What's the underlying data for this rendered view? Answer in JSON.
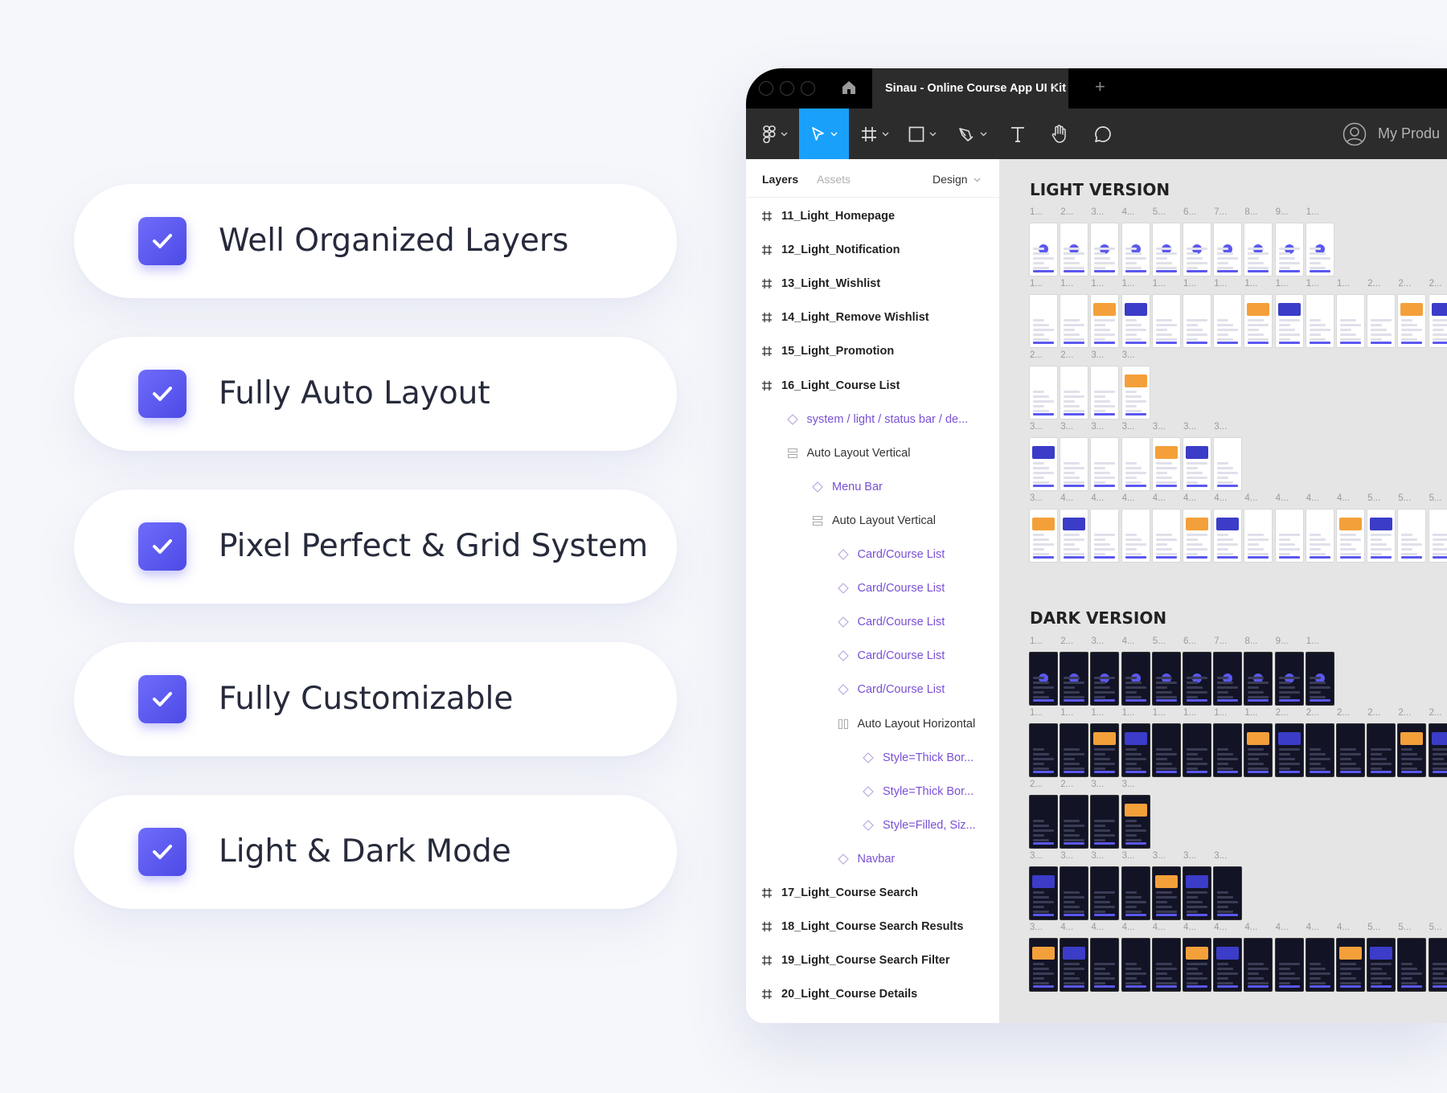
{
  "features": [
    {
      "label": "Well Organized Layers"
    },
    {
      "label": "Fully Auto Layout"
    },
    {
      "label": "Pixel Perfect & Grid System"
    },
    {
      "label": "Fully Customizable"
    },
    {
      "label": "Light & Dark Mode"
    }
  ],
  "window": {
    "tab_title": "Sinau - Online Course App UI Kit",
    "tab_close": "×",
    "new_tab": "+",
    "profile_label": "My Produ"
  },
  "panel": {
    "tabs": [
      "Layers",
      "Assets"
    ],
    "design_label": "Design",
    "layers": [
      {
        "label": "11_Light_Homepage",
        "kind": "frame",
        "indent": 0
      },
      {
        "label": "12_Light_Notification",
        "kind": "frame",
        "indent": 0
      },
      {
        "label": "13_Light_Wishlist",
        "kind": "frame",
        "indent": 0
      },
      {
        "label": "14_Light_Remove Wishlist",
        "kind": "frame",
        "indent": 0
      },
      {
        "label": "15_Light_Promotion",
        "kind": "frame",
        "indent": 0
      },
      {
        "label": "16_Light_Course List",
        "kind": "frame",
        "indent": 0
      },
      {
        "label": "system / light / status bar / de...",
        "kind": "comp",
        "indent": 1
      },
      {
        "label": "Auto Layout Vertical",
        "kind": "autov",
        "indent": 1
      },
      {
        "label": "Menu Bar",
        "kind": "comp",
        "indent": 2
      },
      {
        "label": "Auto Layout Vertical",
        "kind": "autov",
        "indent": 2
      },
      {
        "label": "Card/Course List",
        "kind": "comp",
        "indent": 3
      },
      {
        "label": "Card/Course List",
        "kind": "comp",
        "indent": 3
      },
      {
        "label": "Card/Course List",
        "kind": "comp",
        "indent": 3
      },
      {
        "label": "Card/Course List",
        "kind": "comp",
        "indent": 3
      },
      {
        "label": "Card/Course List",
        "kind": "comp",
        "indent": 3
      },
      {
        "label": "Auto Layout Horizontal",
        "kind": "autoh",
        "indent": 3
      },
      {
        "label": "Style=Thick Bor...",
        "kind": "comp",
        "indent": 4
      },
      {
        "label": "Style=Thick Bor...",
        "kind": "comp",
        "indent": 4
      },
      {
        "label": "Style=Filled, Siz...",
        "kind": "comp",
        "indent": 4
      },
      {
        "label": "Navbar",
        "kind": "comp",
        "indent": 3
      },
      {
        "label": "17_Light_Course Search",
        "kind": "frame",
        "indent": 0
      },
      {
        "label": "18_Light_Course Search Results",
        "kind": "frame",
        "indent": 0
      },
      {
        "label": "19_Light_Course Search Filter",
        "kind": "frame",
        "indent": 0
      },
      {
        "label": "20_Light_Course Details",
        "kind": "frame",
        "indent": 0
      }
    ]
  },
  "canvas": {
    "light_title": "LIGHT VERSION",
    "dark_title": "DARK VERSION",
    "rows": [
      {
        "labels": [
          "1...",
          "2...",
          "3...",
          "4...",
          "5...",
          "6...",
          "7...",
          "8...",
          "9...",
          "1..."
        ]
      },
      {
        "labels": [
          "1...",
          "1...",
          "1...",
          "1...",
          "1...",
          "1...",
          "1...",
          "1...",
          "1...",
          "1...",
          "1...",
          "2...",
          "2...",
          "2..."
        ]
      },
      {
        "labels": [
          "2...",
          "2...",
          "3...",
          "3..."
        ]
      },
      {
        "labels": [
          "3...",
          "3...",
          "3...",
          "3...",
          "3...",
          "3...",
          "3..."
        ]
      },
      {
        "labels": [
          "3...",
          "4...",
          "4...",
          "4...",
          "4...",
          "4...",
          "4...",
          "4...",
          "4...",
          "4...",
          "4...",
          "5...",
          "5...",
          "5..."
        ]
      }
    ],
    "dark_rows": [
      {
        "labels": [
          "1...",
          "2...",
          "3...",
          "4...",
          "5...",
          "6...",
          "7...",
          "8...",
          "9...",
          "1..."
        ]
      },
      {
        "labels": [
          "1...",
          "1...",
          "1...",
          "1...",
          "1...",
          "1...",
          "1...",
          "1...",
          "2...",
          "2...",
          "2...",
          "2...",
          "2...",
          "2..."
        ]
      },
      {
        "labels": [
          "2...",
          "2...",
          "3...",
          "3..."
        ]
      },
      {
        "labels": [
          "3...",
          "3...",
          "3...",
          "3...",
          "3...",
          "3...",
          "3..."
        ]
      },
      {
        "labels": [
          "3...",
          "4...",
          "4...",
          "4...",
          "4...",
          "4...",
          "4...",
          "4...",
          "4...",
          "4...",
          "4...",
          "5...",
          "5...",
          "5..."
        ]
      }
    ]
  },
  "colors": {
    "accent": "#5b58f0",
    "figma_blue": "#18a0fb",
    "component_purple": "#7a50d6"
  }
}
